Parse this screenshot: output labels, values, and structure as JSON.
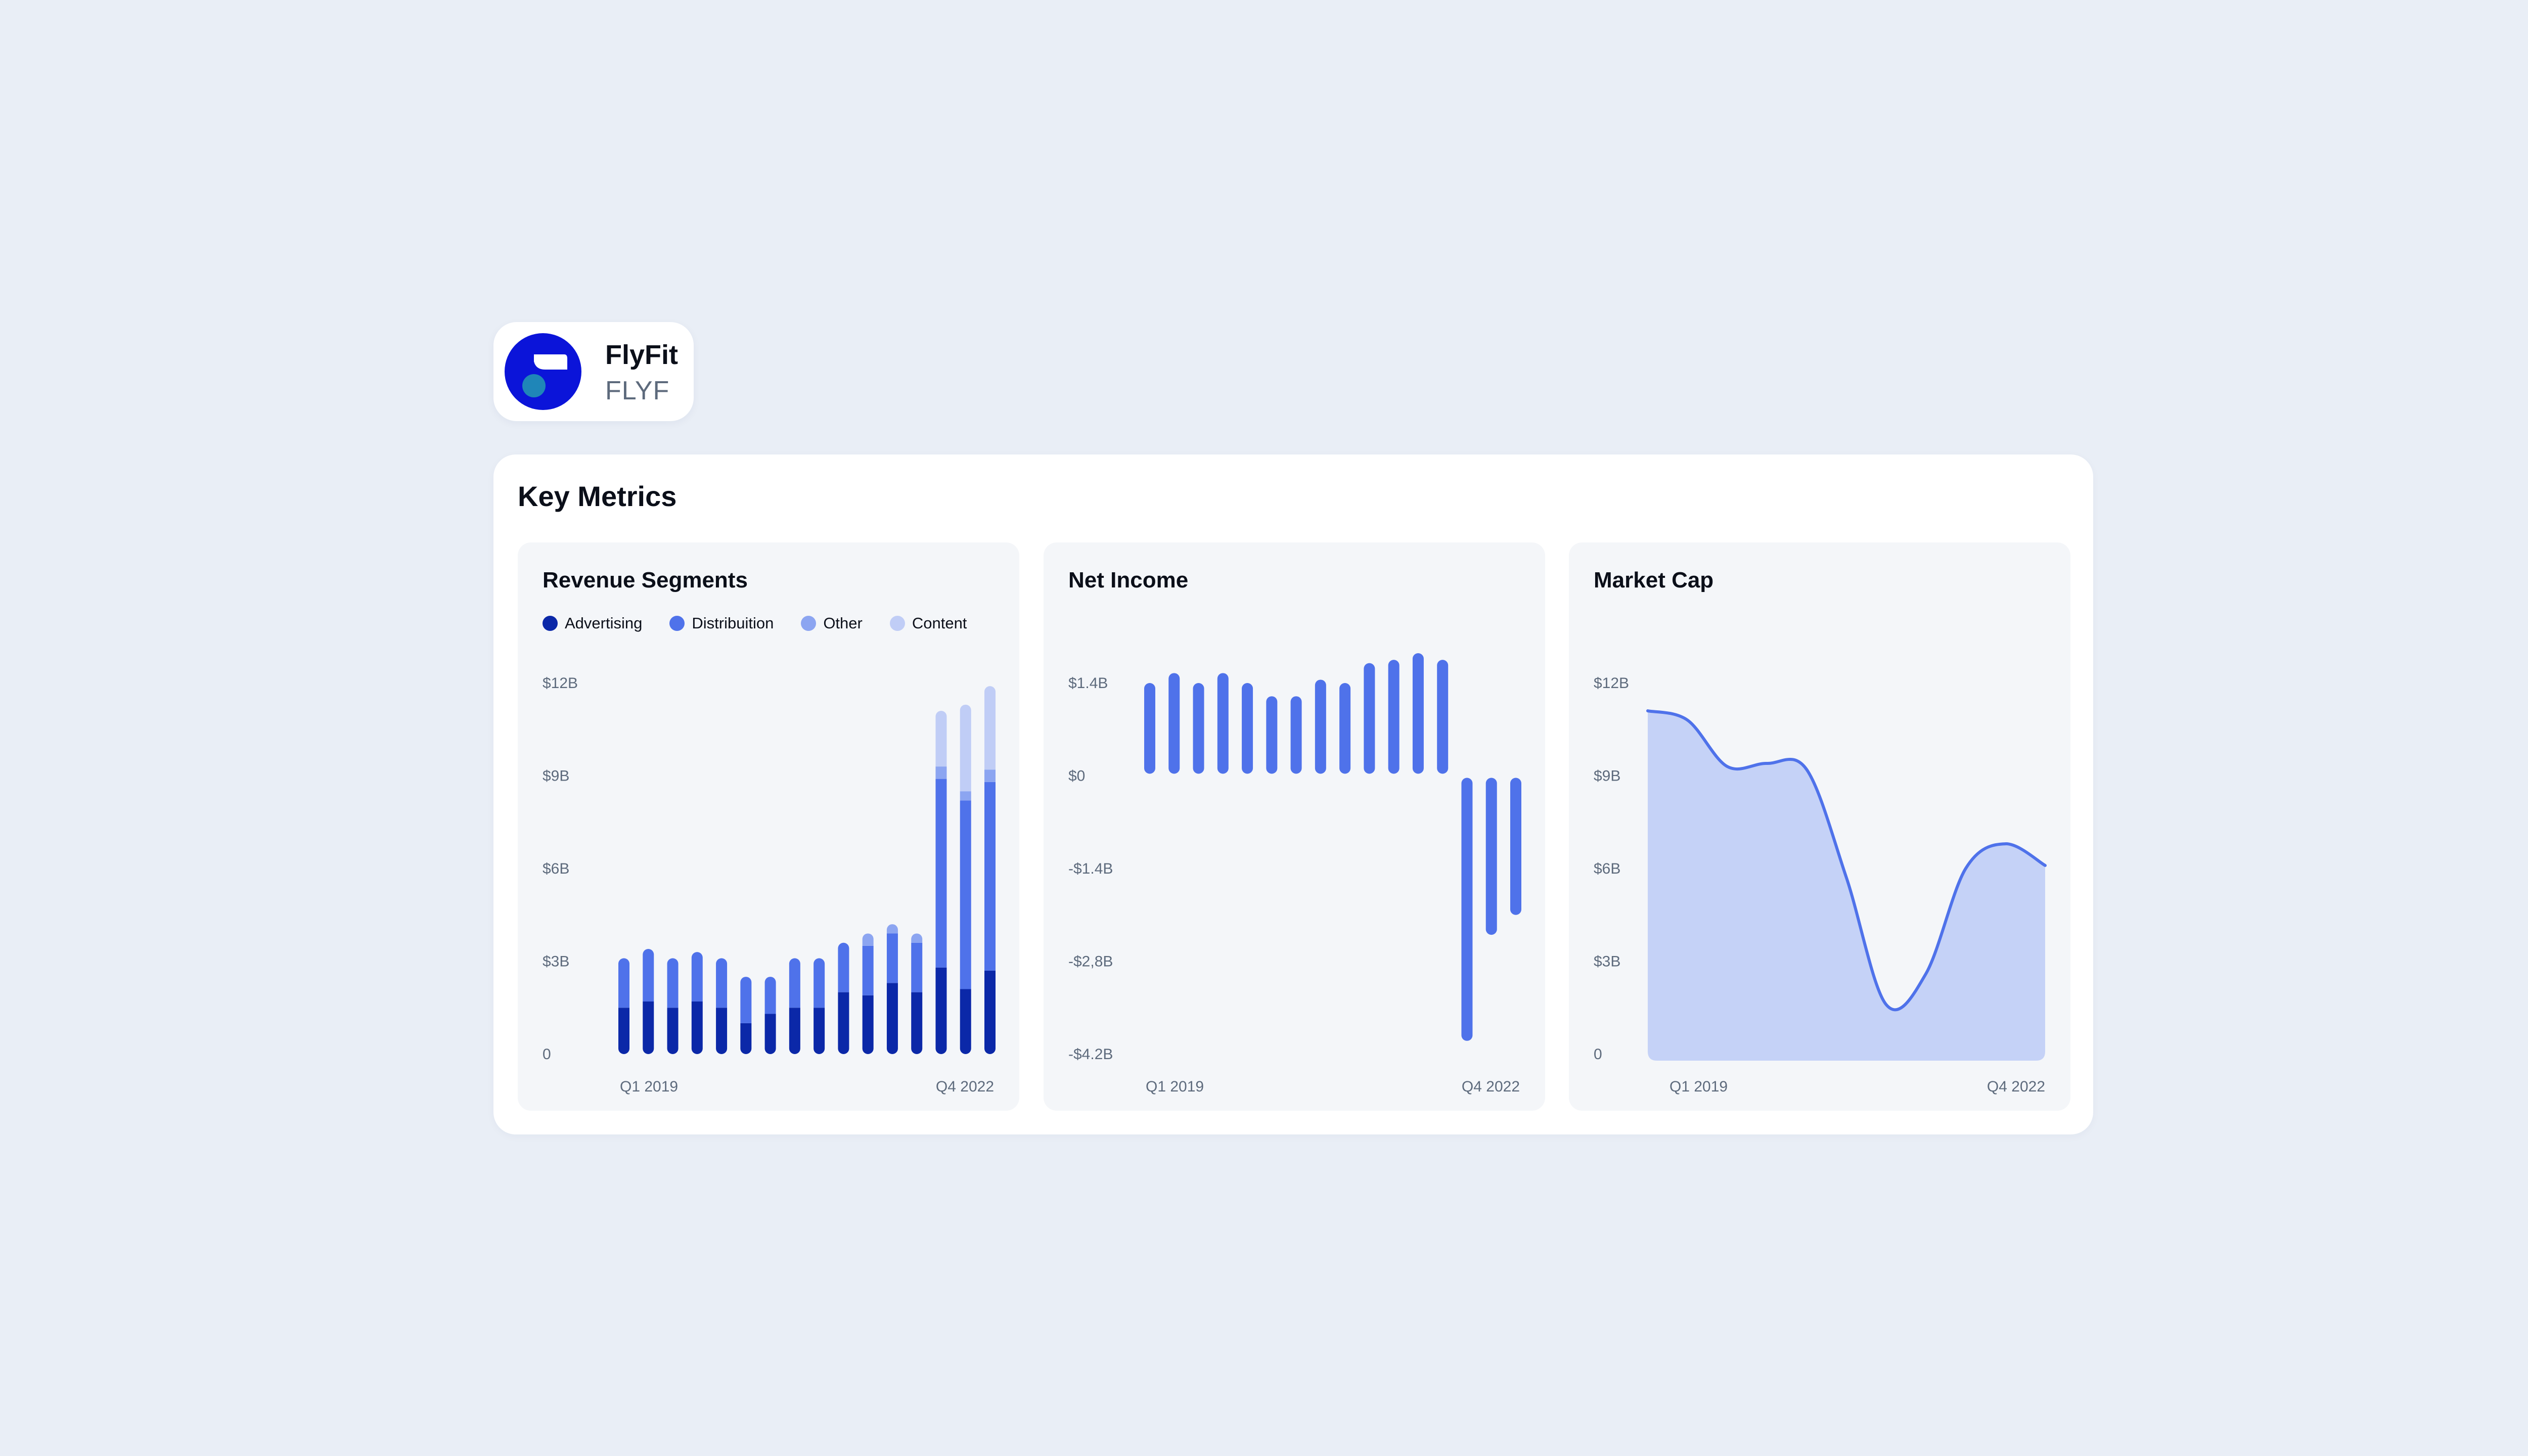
{
  "company": {
    "name": "FlyFit",
    "ticker": "FLYF",
    "logo_icon": "flyfit-logo-icon",
    "logo_colors": {
      "circle": "#0b14d9",
      "shape": "#ffffff",
      "dot": "#1f86b8"
    }
  },
  "metrics": {
    "title": "Key Metrics"
  },
  "colors": {
    "advertising": "#0b28a8",
    "distribution": "#4f72ea",
    "other": "#8ca5f1",
    "content": "#c0cdf6",
    "net_income": "#4f72ea",
    "market_cap_line": "#4f72ea",
    "market_cap_fill": "#c5d2f7",
    "axis_text": "#5d6a7c"
  },
  "chart_data": [
    {
      "id": "revenue",
      "type": "bar",
      "title": "Revenue Segments",
      "stacked": true,
      "y_ticks": [
        "$12B",
        "$9B",
        "$6B",
        "$3B",
        "0"
      ],
      "ylim": [
        0,
        12
      ],
      "x_labels": [
        "Q1 2019",
        "Q4 2022"
      ],
      "legend": [
        "Advertising",
        "Distribuition",
        "Other",
        "Content"
      ],
      "legend_position": "top-left",
      "grid": false,
      "categories_count": 16,
      "series": [
        {
          "name": "Advertising",
          "color_key": "advertising",
          "values": [
            1.5,
            1.7,
            1.5,
            1.7,
            1.5,
            1.0,
            1.3,
            1.5,
            1.5,
            2.0,
            1.9,
            2.3,
            2.0,
            2.8,
            2.1,
            2.7
          ]
        },
        {
          "name": "Distribuition",
          "color_key": "distribution",
          "values": [
            1.6,
            1.7,
            1.6,
            1.6,
            1.6,
            1.5,
            1.2,
            1.6,
            1.6,
            1.6,
            1.6,
            1.6,
            1.6,
            6.1,
            6.1,
            6.1
          ]
        },
        {
          "name": "Other",
          "color_key": "other",
          "values": [
            0,
            0,
            0,
            0,
            0,
            0,
            0,
            0,
            0,
            0,
            0.4,
            0.3,
            0.3,
            0.4,
            0.3,
            0.4
          ]
        },
        {
          "name": "Content",
          "color_key": "content",
          "values": [
            0,
            0,
            0,
            0,
            0,
            0,
            0,
            0,
            0,
            0,
            0,
            0,
            0,
            1.8,
            2.8,
            2.7
          ]
        }
      ]
    },
    {
      "id": "netincome",
      "type": "bar",
      "title": "Net Income",
      "y_ticks": [
        "$1.4B",
        "$0",
        "-$1.4B",
        "-$2,8B",
        "-$4.2B"
      ],
      "ylim": [
        -4.2,
        1.4
      ],
      "x_labels": [
        "Q1 2019",
        "Q4 2022"
      ],
      "grid": false,
      "series": [
        {
          "name": "",
          "color_key": "net_income",
          "values": [
            1.4,
            1.55,
            1.4,
            1.55,
            1.4,
            1.2,
            1.2,
            1.45,
            1.4,
            1.7,
            1.75,
            1.85,
            1.75,
            -4.0,
            -2.4,
            -2.1
          ]
        }
      ]
    },
    {
      "id": "marketcap",
      "type": "area",
      "title": "Market Cap",
      "y_ticks": [
        "$12B",
        "$9B",
        "$6B",
        "$3B",
        "0"
      ],
      "ylim": [
        0,
        12
      ],
      "x_labels": [
        "Q1 2019",
        "Q4 2022"
      ],
      "grid": false,
      "series": [
        {
          "name": "",
          "color_key": "market_cap_line",
          "values": [
            11.1,
            10.8,
            9.3,
            9.4,
            9.2,
            5.7,
            1.6,
            2.6,
            6.0,
            6.8,
            6.1
          ]
        }
      ]
    }
  ]
}
